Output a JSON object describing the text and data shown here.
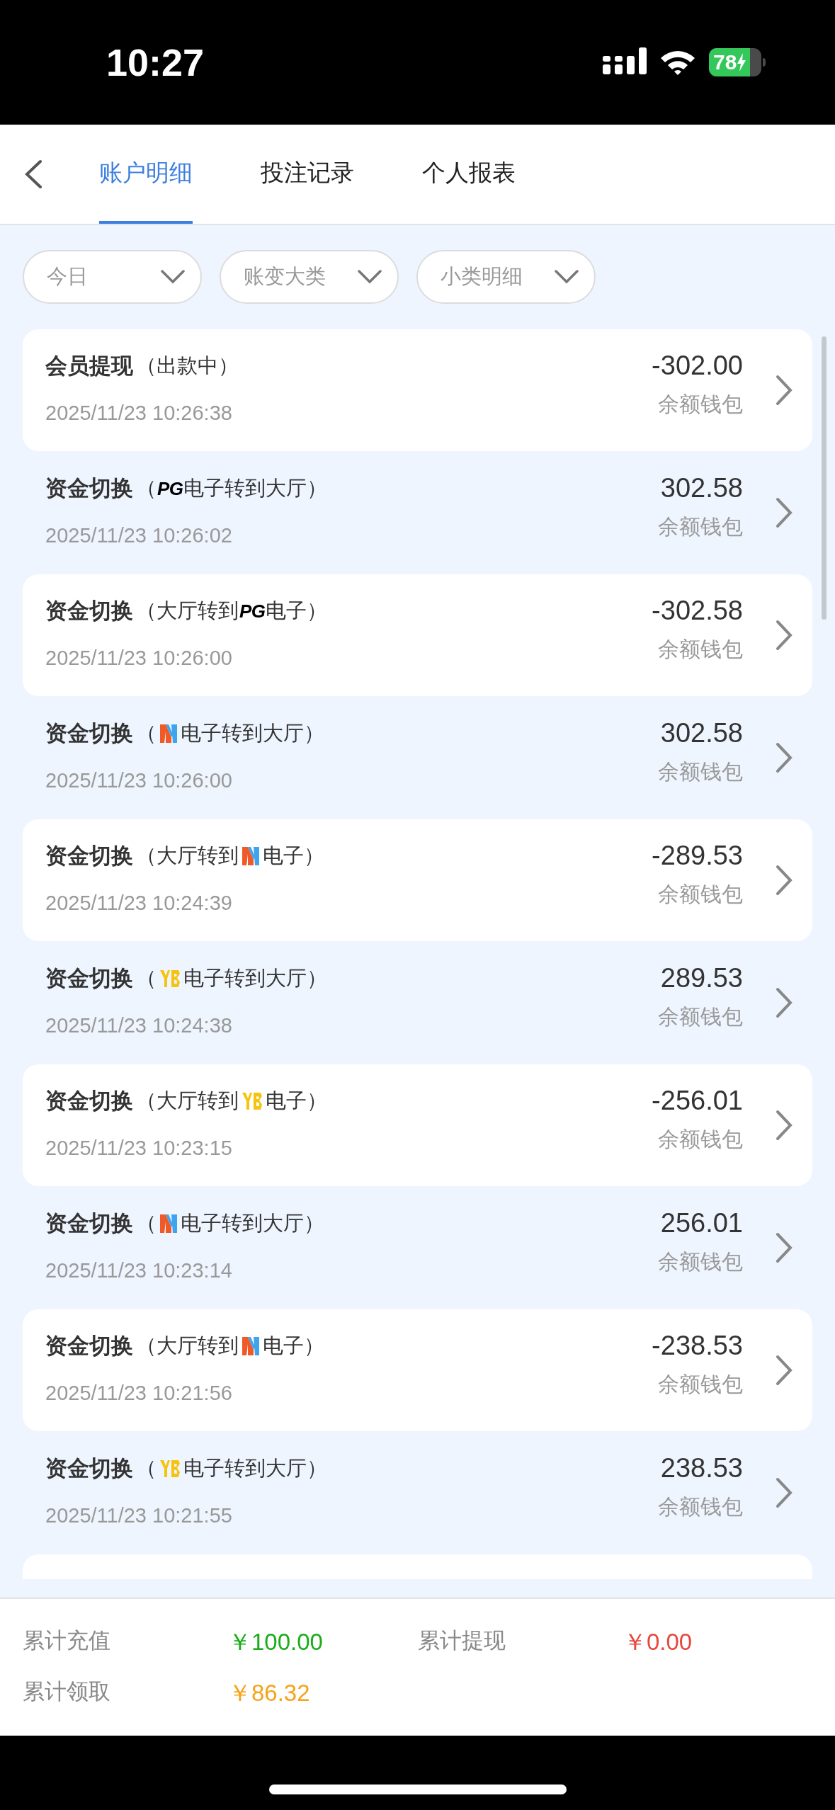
{
  "status_bar": {
    "time": "10:27",
    "battery": "78"
  },
  "tabs": [
    {
      "label": "账户明细",
      "selected": true
    },
    {
      "label": "投注记录",
      "selected": false
    },
    {
      "label": "个人报表",
      "selected": false
    }
  ],
  "filters": [
    "今日",
    "账变大类",
    "小类明细"
  ],
  "records": [
    {
      "title": "会员提现",
      "detail": [
        {
          "kind": "text",
          "text": "（出款中）"
        }
      ],
      "time": "2025/11/23 10:26:38",
      "amount": "-302.00",
      "wallet": "余额钱包"
    },
    {
      "title": "资金切换",
      "detail": [
        {
          "kind": "text",
          "text": "（"
        },
        {
          "kind": "pg",
          "text": "PG"
        },
        {
          "kind": "text",
          "text": "电子转到大厅）"
        }
      ],
      "time": "2025/11/23 10:26:02",
      "amount": "302.58",
      "wallet": "余额钱包"
    },
    {
      "title": "资金切换",
      "detail": [
        {
          "kind": "text",
          "text": "（大厅转到"
        },
        {
          "kind": "pg",
          "text": "PG"
        },
        {
          "kind": "text",
          "text": "电子）"
        }
      ],
      "time": "2025/11/23 10:26:00",
      "amount": "-302.58",
      "wallet": "余额钱包"
    },
    {
      "title": "资金切换",
      "detail": [
        {
          "kind": "text",
          "text": "（"
        },
        {
          "kind": "mw"
        },
        {
          "kind": "text",
          "text": "电子转到大厅）"
        }
      ],
      "time": "2025/11/23 10:26:00",
      "amount": "302.58",
      "wallet": "余额钱包"
    },
    {
      "title": "资金切换",
      "detail": [
        {
          "kind": "text",
          "text": "（大厅转到"
        },
        {
          "kind": "mw"
        },
        {
          "kind": "text",
          "text": "电子）"
        }
      ],
      "time": "2025/11/23 10:24:39",
      "amount": "-289.53",
      "wallet": "余额钱包"
    },
    {
      "title": "资金切换",
      "detail": [
        {
          "kind": "text",
          "text": "（"
        },
        {
          "kind": "yb"
        },
        {
          "kind": "text",
          "text": "电子转到大厅）"
        }
      ],
      "time": "2025/11/23 10:24:38",
      "amount": "289.53",
      "wallet": "余额钱包"
    },
    {
      "title": "资金切换",
      "detail": [
        {
          "kind": "text",
          "text": "（大厅转到"
        },
        {
          "kind": "yb"
        },
        {
          "kind": "text",
          "text": "电子）"
        }
      ],
      "time": "2025/11/23 10:23:15",
      "amount": "-256.01",
      "wallet": "余额钱包"
    },
    {
      "title": "资金切换",
      "detail": [
        {
          "kind": "text",
          "text": "（"
        },
        {
          "kind": "mw"
        },
        {
          "kind": "text",
          "text": "电子转到大厅）"
        }
      ],
      "time": "2025/11/23 10:23:14",
      "amount": "256.01",
      "wallet": "余额钱包"
    },
    {
      "title": "资金切换",
      "detail": [
        {
          "kind": "text",
          "text": "（大厅转到"
        },
        {
          "kind": "mw"
        },
        {
          "kind": "text",
          "text": "电子）"
        }
      ],
      "time": "2025/11/23 10:21:56",
      "amount": "-238.53",
      "wallet": "余额钱包"
    },
    {
      "title": "资金切换",
      "detail": [
        {
          "kind": "text",
          "text": "（"
        },
        {
          "kind": "yb"
        },
        {
          "kind": "text",
          "text": "电子转到大厅）"
        }
      ],
      "time": "2025/11/23 10:21:55",
      "amount": "238.53",
      "wallet": "余额钱包"
    }
  ],
  "summary": [
    {
      "label": "累计充值",
      "value": "￥100.00",
      "color": "#1aad19"
    },
    {
      "label": "累计提现",
      "value": "￥0.00",
      "color": "#e8473c"
    },
    {
      "label": "累计领取",
      "value": "￥86.32",
      "color": "#f5a31a"
    }
  ]
}
